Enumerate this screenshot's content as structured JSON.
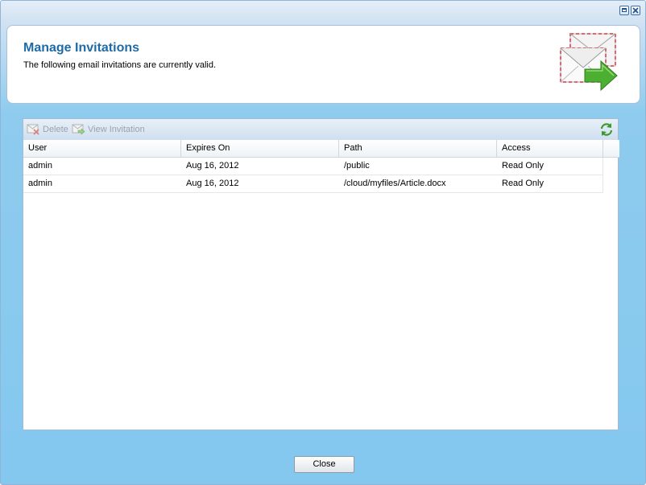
{
  "window": {
    "controls": [
      "maximize",
      "close"
    ]
  },
  "header": {
    "title": "Manage Invitations",
    "subtitle": "The following email invitations are currently valid.",
    "icon": "email-invitation-icon"
  },
  "toolbar": {
    "delete_label": "Delete",
    "view_label": "View Invitation",
    "refresh_icon": "refresh-icon"
  },
  "table": {
    "columns": [
      "User",
      "Expires On",
      "Path",
      "Access"
    ],
    "rows": [
      [
        "admin",
        "Aug 16, 2012",
        "/public",
        "Read Only"
      ],
      [
        "admin",
        "Aug 16, 2012",
        "/cloud/myfiles/Article.docx",
        "Read Only"
      ]
    ]
  },
  "footer": {
    "close_label": "Close"
  },
  "colors": {
    "title": "#1e6ba8",
    "background": "#84c8ef",
    "disabled_text": "#9aa3ac"
  }
}
